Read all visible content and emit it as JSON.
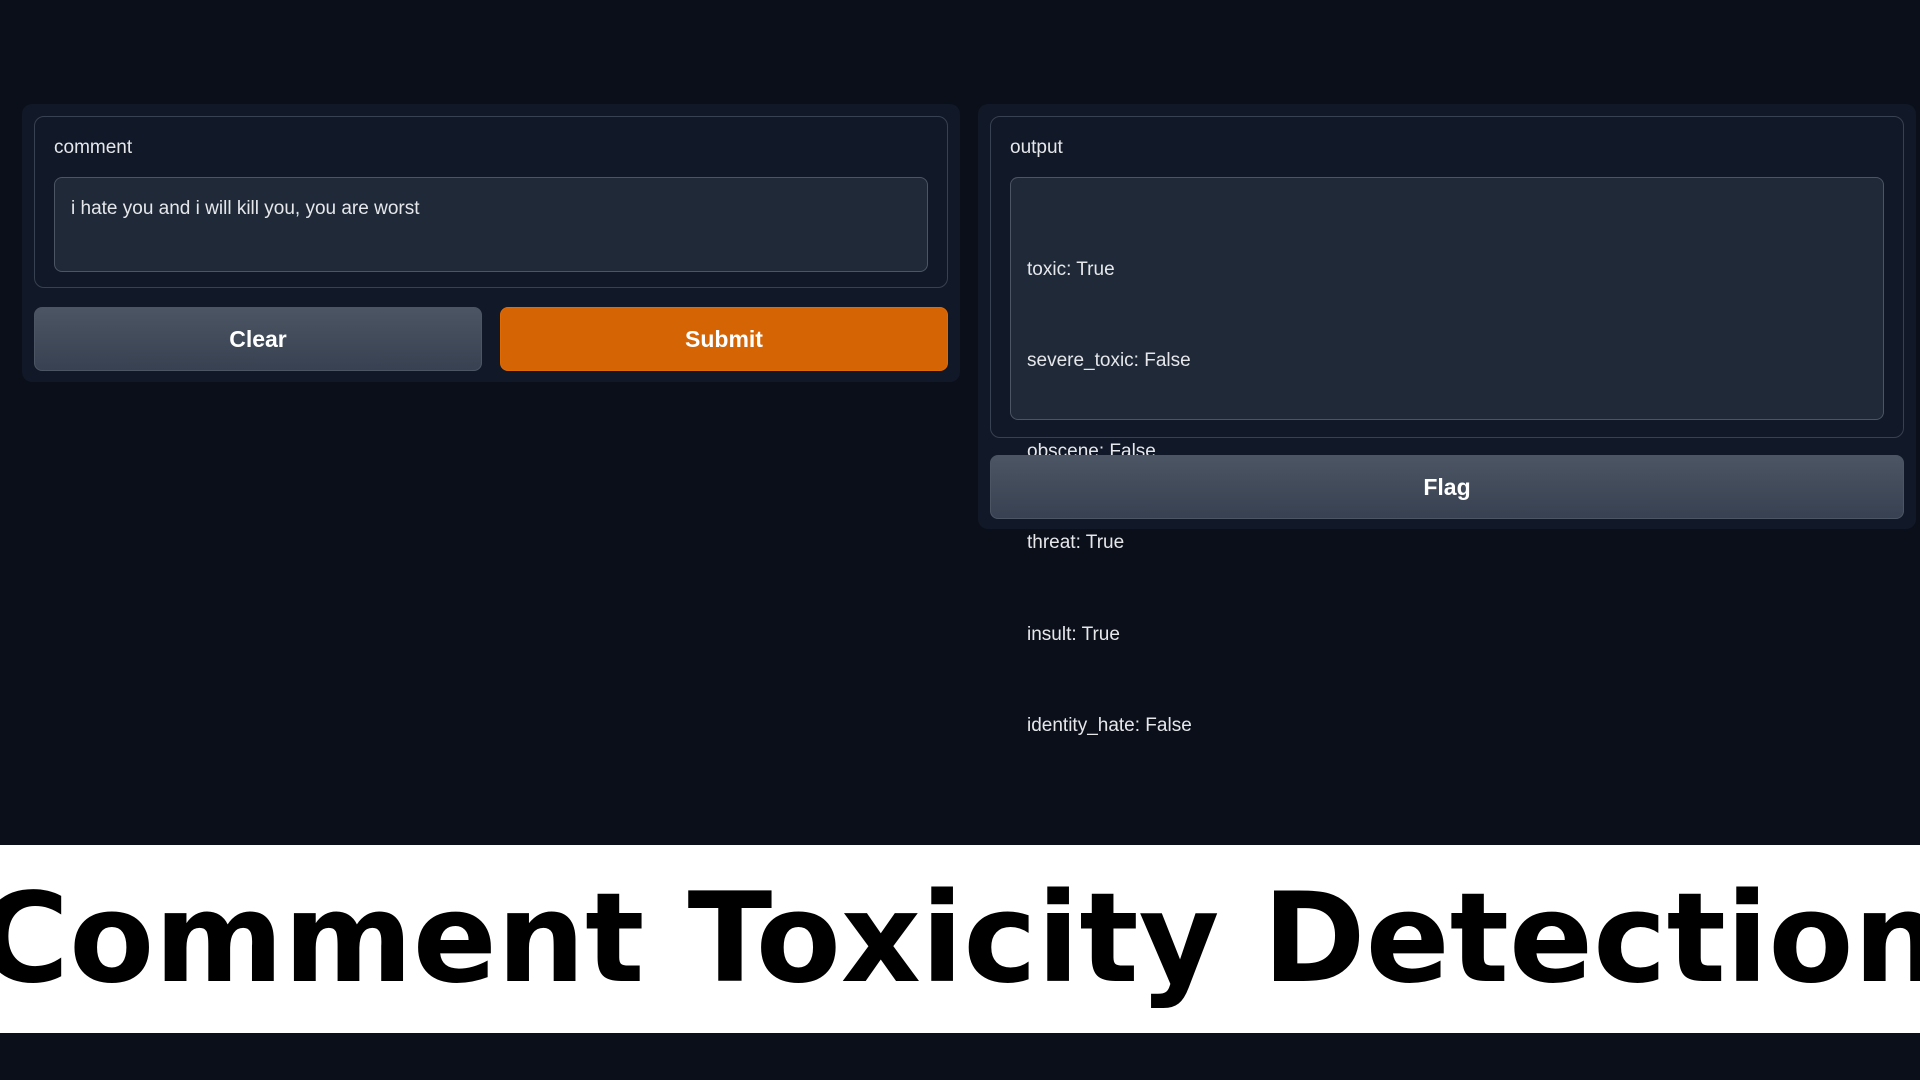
{
  "input": {
    "label": "comment",
    "value": "i hate you and i will kill you, you are worst"
  },
  "buttons": {
    "clear_label": "Clear",
    "submit_label": "Submit",
    "flag_label": "Flag"
  },
  "output": {
    "label": "output",
    "lines": [
      "toxic: True",
      "severe_toxic: False",
      "obscene: False",
      "threat: True",
      "insult: True",
      "identity_hate: False"
    ]
  },
  "banner": {
    "title": "Comment Toxicity Detection"
  },
  "colors": {
    "background": "#0b0f19",
    "panel": "#111827",
    "submit_accent": "#d56404",
    "banner_background": "#ffffff"
  }
}
